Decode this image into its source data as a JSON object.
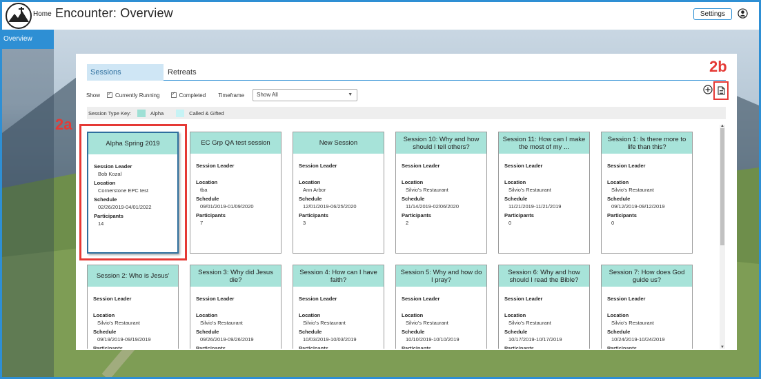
{
  "header": {
    "home_label": "Home",
    "title": "Encounter: Overview",
    "settings_label": "Settings"
  },
  "nav": {
    "overview_label": "Overview"
  },
  "tabs": [
    {
      "label": "Sessions",
      "active": true
    },
    {
      "label": "Retreats",
      "active": false
    }
  ],
  "filters": {
    "show_label": "Show",
    "currently_running_label": "Currently Running",
    "completed_label": "Completed",
    "timeframe_label": "Timeframe",
    "timeframe_value": "Show All"
  },
  "key": {
    "label": "Session Type Key:",
    "items": [
      {
        "name": "Alpha",
        "color": "#9ee0d5"
      },
      {
        "name": "Called & Gifted",
        "color": "#c6f3f5"
      }
    ]
  },
  "field_labels": {
    "leader": "Session Leader",
    "location": "Location",
    "schedule": "Schedule",
    "participants": "Participants"
  },
  "cards": [
    {
      "title": "Alpha Spring 2019",
      "leader": "Bob Kozal",
      "location": "Cornerstone EPC test",
      "schedule": "02/26/2019-04/01/2022",
      "participants": "14"
    },
    {
      "title": "EC Grp QA test session",
      "leader": "",
      "location": "tba",
      "schedule": "09/01/2019-01/09/2020",
      "participants": "7"
    },
    {
      "title": "New Session",
      "leader": "",
      "location": "Ann Arbor",
      "schedule": "12/01/2019-06/25/2020",
      "participants": "3"
    },
    {
      "title": "Session 10: Why and how should I tell others?",
      "leader": "",
      "location": "Silvio's Restaurant",
      "schedule": "11/14/2019-02/06/2020",
      "participants": "2"
    },
    {
      "title": "Session 11: How can I make the most of my ...",
      "leader": "",
      "location": "Silvio's Restaurant",
      "schedule": "11/21/2019-11/21/2019",
      "participants": "0"
    },
    {
      "title": "Session 1: Is there more to life than this?",
      "leader": "",
      "location": "Silvio's Restaurant",
      "schedule": "09/12/2019-09/12/2019",
      "participants": "0"
    },
    {
      "title": "Session 2: Who is Jesus'",
      "leader": "",
      "location": "Silvio's Restaurant",
      "schedule": "09/19/2019-09/19/2019",
      "participants": ""
    },
    {
      "title": "Session 3: Why did Jesus die?",
      "leader": "",
      "location": "Silvio's Restaurant",
      "schedule": "09/26/2019-09/26/2019",
      "participants": ""
    },
    {
      "title": "Session 4: How can I have faith?",
      "leader": "",
      "location": "Silvio's Restaurant",
      "schedule": "10/03/2019-10/03/2019",
      "participants": ""
    },
    {
      "title": "Session 5: Why and how do I pray?",
      "leader": "",
      "location": "Silvio's Restaurant",
      "schedule": "10/10/2019-10/10/2019",
      "participants": ""
    },
    {
      "title": "Session 6: Why and how should I read the Bible?",
      "leader": "",
      "location": "Silvio's Restaurant",
      "schedule": "10/17/2019-10/17/2019",
      "participants": ""
    },
    {
      "title": "Session 7: How does God guide us?",
      "leader": "",
      "location": "Silvio's Restaurant",
      "schedule": "10/24/2019-10/24/2019",
      "participants": ""
    }
  ],
  "annotations": {
    "a": "2a",
    "b": "2b"
  },
  "colors": {
    "accent": "#2e8fd4",
    "card_header": "#a7e3d9",
    "annotation": "#e53935"
  }
}
